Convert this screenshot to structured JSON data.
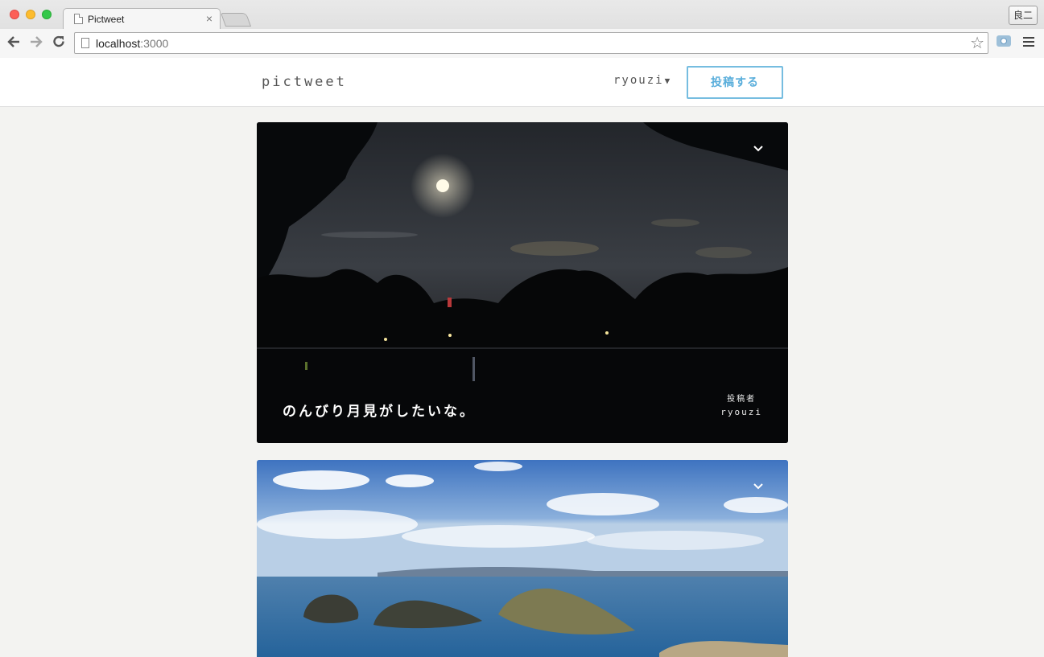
{
  "browser": {
    "tab_title": "Pictweet",
    "tab_close": "×",
    "profile_label": "良二",
    "url_host": "localhost",
    "url_port": ":3000",
    "icons": [
      "back-arrow-icon",
      "forward-arrow-icon",
      "reload-icon",
      "page-icon",
      "bookmark-star-icon",
      "camera-icon",
      "menu-icon"
    ]
  },
  "header": {
    "logo": "PICTWEET",
    "user_name": "ryouzi",
    "user_caret": "▼",
    "post_button": "投稿する"
  },
  "tweets": [
    {
      "caption": "のんびり月見がしたいな。",
      "poster_label": "投稿者",
      "poster_name": "ryouzi",
      "image": "night-park-moon"
    },
    {
      "caption": "",
      "image": "sea-islands"
    }
  ],
  "colors": {
    "accent": "#5aaedb",
    "page_bg": "#f3f3f1"
  }
}
